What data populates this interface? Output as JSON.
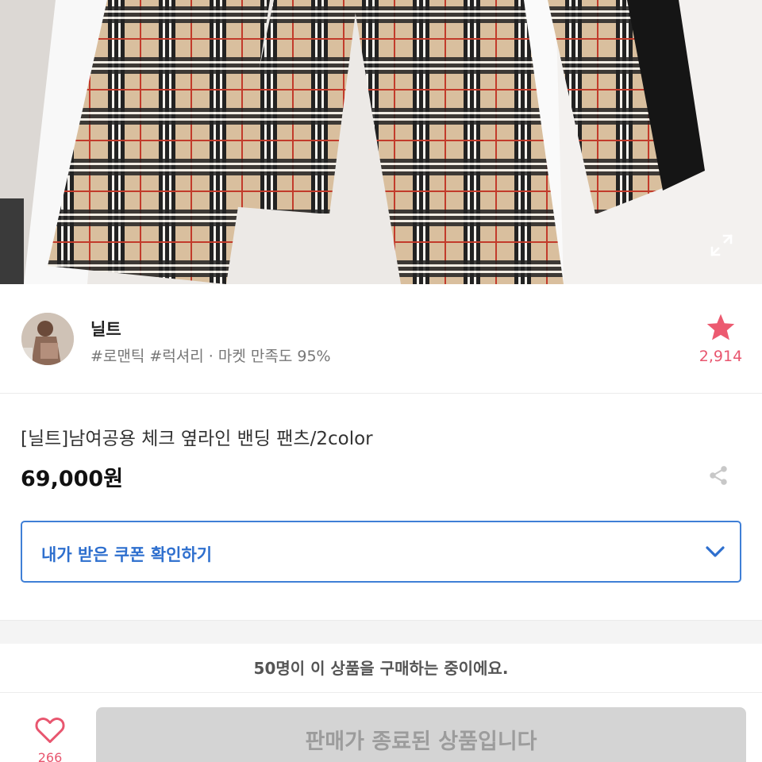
{
  "hero": {
    "alt": "체크 팬츠 상품 이미지",
    "expand_icon": "expand-icon"
  },
  "seller": {
    "name": "닐트",
    "tags": "#로맨틱 #럭셔리 · 마켓 만족도 95%",
    "favorite_count": "2,914",
    "favorite_icon": "star-icon"
  },
  "product": {
    "title": "[닐트]남여공용 체크 옆라인 밴딩 팬츠/2color",
    "price": "69,000원",
    "share_icon": "share-icon"
  },
  "coupon": {
    "label": "내가 받은 쿠폰 확인하기",
    "icon": "chevron-down-icon"
  },
  "buying_notice": "50명이 이 상품을 구매하는 중이에요.",
  "bottom_bar": {
    "like_count": "266",
    "like_icon": "heart-icon",
    "status_button": "판매가 종료된 상품입니다"
  },
  "colors": {
    "accent_blue": "#3f7fd6",
    "accent_pink": "#e8566f",
    "disabled_gray": "#d4d4d4"
  }
}
